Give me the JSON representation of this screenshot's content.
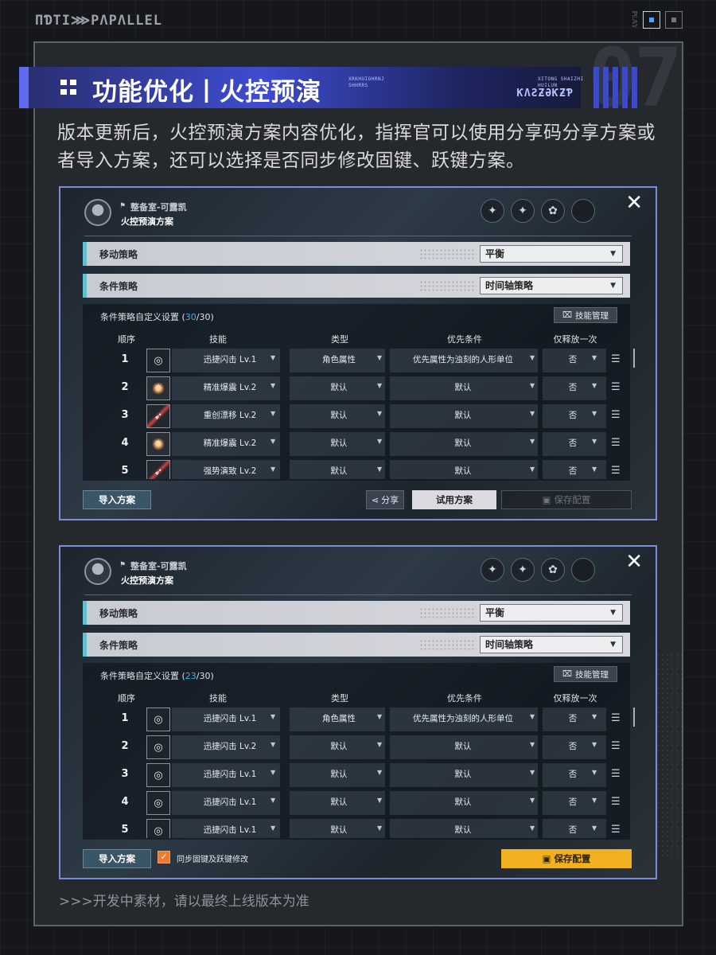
{
  "brand": "ПƊTI⋙PΛPΛLLEL",
  "pager": {
    "label": "ℙ𝕃𝔸𝕐"
  },
  "page_number": "07",
  "header": {
    "title": "功能优化丨火控预演",
    "deco_small": "XRKHUIOHRNJ\nSHHRRS",
    "deco_small2": "XITONG SHAIZHI\nHUILUN",
    "deco_logo": "ƘΛƧƵƏƘƵƤ"
  },
  "description": "版本更新后，火控预演方案内容优化，指挥官可以使用分享码分享方案或者导入方案，还可以选择是否同步修改固键、跃键方案。",
  "screens": [
    {
      "location": "整备室-可露凯",
      "plan_title": "火控预演方案",
      "badges": [
        "✦",
        "✦",
        "✿",
        ""
      ],
      "move_strategy": {
        "label": "移动策略",
        "value": "平衡"
      },
      "cond_strategy": {
        "label": "条件策略",
        "value": "时间轴策略"
      },
      "custom": {
        "prefix": "条件策略自定义设置 (",
        "count": "30",
        "suffix": "/30)"
      },
      "skill_btn": "技能管理",
      "columns": [
        "顺序",
        "技能",
        "类型",
        "优先条件",
        "仅释放一次"
      ],
      "rows": [
        {
          "n": "1",
          "icon": "circle",
          "skill": "迅捷闪击 Lv.1",
          "type": "角色属性",
          "priority": "优先属性为浊刻的人形单位",
          "once": "否"
        },
        {
          "n": "2",
          "icon": "burst",
          "skill": "精准爆震 Lv.2",
          "type": "默认",
          "priority": "默认",
          "once": "否"
        },
        {
          "n": "3",
          "icon": "slash",
          "skill": "重创漂移 Lv.2",
          "type": "默认",
          "priority": "默认",
          "once": "否"
        },
        {
          "n": "4",
          "icon": "burst",
          "skill": "精准爆震 Lv.2",
          "type": "默认",
          "priority": "默认",
          "once": "否"
        },
        {
          "n": "5",
          "icon": "slash",
          "skill": "强势演致 Lv.2",
          "type": "默认",
          "priority": "默认",
          "once": "否"
        }
      ],
      "import_btn": "导入方案",
      "share_btn": "分享",
      "try_btn": "试用方案",
      "save_btn": "保存配置"
    },
    {
      "location": "整备室-可露凯",
      "plan_title": "火控预演方案",
      "badges": [
        "✦",
        "✦",
        "✿",
        ""
      ],
      "move_strategy": {
        "label": "移动策略",
        "value": "平衡"
      },
      "cond_strategy": {
        "label": "条件策略",
        "value": "时间轴策略"
      },
      "custom": {
        "prefix": "条件策略自定义设置 (",
        "count": "23",
        "suffix": "/30)"
      },
      "skill_btn": "技能管理",
      "columns": [
        "顺序",
        "技能",
        "类型",
        "优先条件",
        "仅释放一次"
      ],
      "rows": [
        {
          "n": "1",
          "icon": "circle",
          "skill": "迅捷闪击 Lv.1",
          "type": "角色属性",
          "priority": "优先属性为浊刻的人形单位",
          "once": "否"
        },
        {
          "n": "2",
          "icon": "circle",
          "skill": "迅捷闪击 Lv.2",
          "type": "默认",
          "priority": "默认",
          "once": "否"
        },
        {
          "n": "3",
          "icon": "circle",
          "skill": "迅捷闪击 Lv.1",
          "type": "默认",
          "priority": "默认",
          "once": "否"
        },
        {
          "n": "4",
          "icon": "circle",
          "skill": "迅捷闪击 Lv.1",
          "type": "默认",
          "priority": "默认",
          "once": "否"
        },
        {
          "n": "5",
          "icon": "circle",
          "skill": "迅捷闪击 Lv.1",
          "type": "默认",
          "priority": "默认",
          "once": "否"
        }
      ],
      "import_btn": "导入方案",
      "sync_label": "同步固键及跃键修改",
      "save_btn": "保存配置"
    }
  ],
  "footer_note": ">>>开发中素材，请以最终上线版本为准",
  "colors": {
    "title_bar": "#3e4cd0",
    "accent_cyan": "#36b6e8",
    "save_yellow": "#f0b020",
    "checkbox_orange": "#ee7a30"
  }
}
